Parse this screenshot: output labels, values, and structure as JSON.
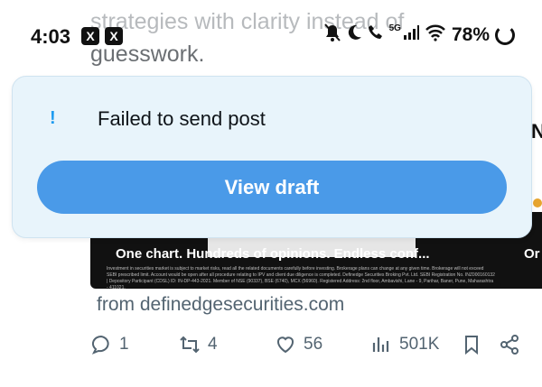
{
  "post": {
    "text_line1": "strategies with clarity instead of",
    "text_line2": "guesswork.",
    "card": {
      "title": "One chart. Hundreds of opinions. Endless conf...",
      "fine_print": "Investment in securities market is subject to market risks, read all the related documents carefully before investing. Brokerage plans can change at any given time. Brokerage will not exceed SEBI prescribed limit. Account would be open after all procedure relating to IPV and client due diligence is completed. Definedge Securities Broking Pvt. Ltd. SEBI Registration No. INZ000160132 | Depository Participant (CDSL) ID: IN-DP-443-2021. Member of NSE (90337), BSE (6740), MCX (56960). Registered Address: 2nd floor, Ambavishi, Lane - 9, Parihar, Baner, Pune, Maharashtra - 411021.",
      "second_title": "Or"
    },
    "side_letters": [
      "N"
    ],
    "from": "from definedgesecurities.com",
    "actions": {
      "replies": "1",
      "reposts": "4",
      "likes": "56",
      "views": "501K"
    }
  },
  "status_bar": {
    "time": "4:03",
    "app_badges": [
      "X",
      "X"
    ],
    "network": "5G",
    "battery": "78%"
  },
  "toast": {
    "icon": "!",
    "message": "Failed to send post",
    "button_label": "View draft"
  },
  "colors": {
    "toast_bg": "#e8f4fb",
    "button_bg": "#4a9ae8",
    "accent": "#1d9bf0",
    "muted_text": "#536471"
  }
}
